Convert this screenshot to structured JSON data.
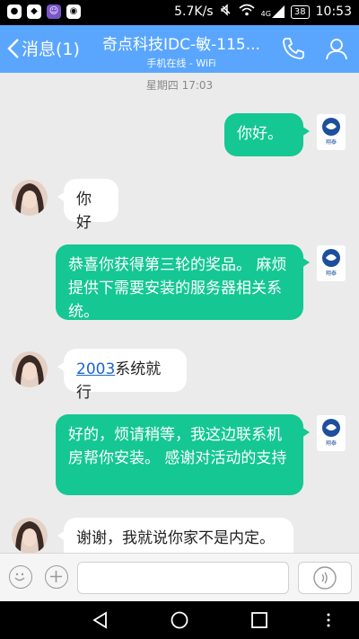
{
  "status": {
    "speed": "5.7K/s",
    "network": "4G",
    "battery": "38",
    "time": "10:53"
  },
  "header": {
    "back_label": "消息(1)",
    "title": "奇点科技IDC-敏-115...",
    "subtitle": "手机在线 - WiFi"
  },
  "chat": {
    "timestamp": "星期四 17:03",
    "avatar_self_label": "翔泰",
    "messages": [
      {
        "from": "self",
        "text": "你好。"
      },
      {
        "from": "other",
        "text": "你好"
      },
      {
        "from": "self",
        "text": "恭喜你获得第三轮的奖品。 麻烦提供下需要安装的服务器相关系统。"
      },
      {
        "from": "other",
        "link": "2003",
        "text": "系统就行"
      },
      {
        "from": "self",
        "text": "好的，烦请稍等，我这边联系机房帮你安装。 感谢对活动的支持"
      },
      {
        "from": "other",
        "text": "谢谢，我就说你家不是内定。"
      }
    ]
  },
  "colors": {
    "header": "#5aa6ff",
    "bubble_out": "#14c793",
    "bubble_in": "#ffffff",
    "background": "#ebebeb"
  },
  "icons": {
    "phone": "phone-icon",
    "contact": "contact-icon",
    "emoji": "emoji-icon",
    "plus": "plus-icon",
    "voice": "voice-icon"
  }
}
